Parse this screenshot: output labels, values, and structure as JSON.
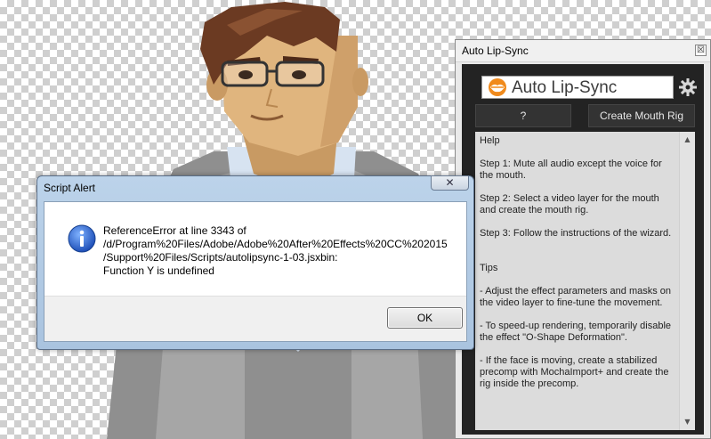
{
  "panel": {
    "title": "Auto Lip-Sync",
    "close_glyph": "☒",
    "brand": "Auto Lip-Sync",
    "help_button": "?",
    "create_rig_button": "Create Mouth Rig",
    "help": {
      "heading": "Help",
      "step1": "Step 1: Mute all audio except the voice for the mouth.",
      "step2": "Step 2: Select a video layer for the mouth and create the mouth rig.",
      "step3": "Step 3: Follow the instructions of the wizard.",
      "tips_heading": "Tips",
      "tip1": "- Adjust the effect parameters and masks on the video layer to fine-tune the movement.",
      "tip2": "- To speed-up rendering, temporarily disable the effect \"O-Shape Deformation\".",
      "tip3": "- If the face is moving, create a stabilized precomp with MochaImport+ and create the rig inside the precomp."
    },
    "scroll_up": "▲",
    "scroll_down": "▼",
    "icons": [
      "lips-icon",
      "gear-icon"
    ]
  },
  "dialog": {
    "title": "Script Alert",
    "close_glyph": "✕",
    "message_lines": [
      "ReferenceError at line 3343 of",
      "/d/Program%20Files/Adobe/Adobe%20After%20Effects%20CC%202015",
      "/Support%20Files/Scripts/autolipsync-1-03.jsxbin:",
      "Function Y is undefined"
    ],
    "ok_label": "OK",
    "icon": "info-icon"
  },
  "colors": {
    "panel_background": "#232323",
    "dialog_frame": "#bcd3ea",
    "brand_accent": "#f08a1c"
  }
}
